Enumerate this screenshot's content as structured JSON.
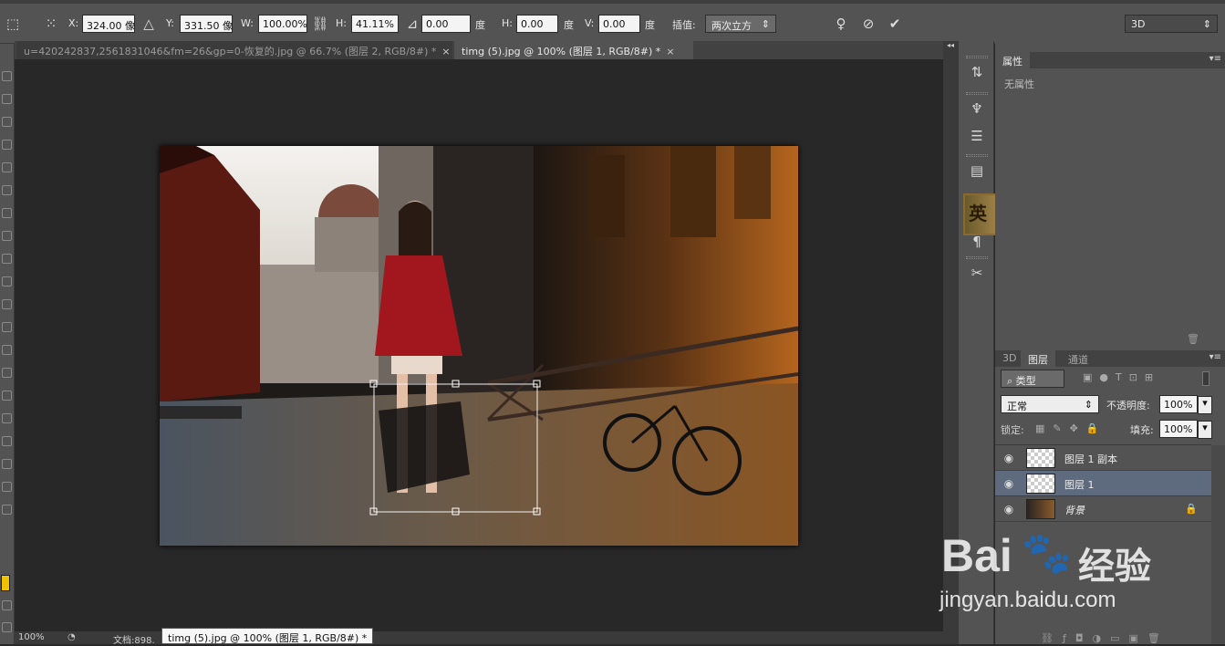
{
  "options": {
    "x_label": "X:",
    "x_value": "324.00 像",
    "y_label": "Y:",
    "y_value": "331.50 像",
    "w_label": "W:",
    "w_value": "100.00%",
    "h_label": "H:",
    "h_value": "41.11%",
    "angle_value": "0.00",
    "hskew_label": "H:",
    "hskew_value": "0.00",
    "deg1": "度",
    "vskew_label": "V:",
    "vskew_value": "0.00",
    "deg2": "度",
    "interp_label": "插值:",
    "interp_value": "两次立方",
    "workspace_value": "3D"
  },
  "doc_tabs": [
    {
      "label": "u=420242837,2561831046&fm=26&gp=0-恢复的.jpg @ 66.7% (图层 2, RGB/8#) *",
      "close": "×"
    },
    {
      "label": "timg (5).jpg @ 100% (图层 1, RGB/8#) *",
      "close": "×"
    }
  ],
  "status": {
    "zoom": "100%",
    "doc_info": "文档:898.",
    "tooltip": "timg (5).jpg @ 100% (图层 1, RGB/8#) *"
  },
  "properties": {
    "tab": "属性",
    "empty_text": "无属性"
  },
  "layers_panel": {
    "tabs": [
      "3D",
      "图层",
      "通道"
    ],
    "filter_kind": "类型",
    "blend_mode": "正常",
    "opacity_label": "不透明度:",
    "opacity_value": "100%",
    "lock_label": "锁定:",
    "fill_label": "填充:",
    "fill_value": "100%",
    "layers": [
      {
        "name": "图层 1 副本",
        "visible": true,
        "selected": false
      },
      {
        "name": "图层 1",
        "visible": true,
        "selected": true
      },
      {
        "name": "背景",
        "visible": true,
        "selected": false,
        "locked": true
      }
    ]
  },
  "watermark": {
    "brand": "Bai",
    "brand_cn": "经验",
    "url": "jingyan.baidu.com"
  },
  "icons": {
    "colors": {
      "foreground": "#f2c200",
      "panel_bg": "#535353",
      "selection": "#5e6a7d"
    }
  }
}
